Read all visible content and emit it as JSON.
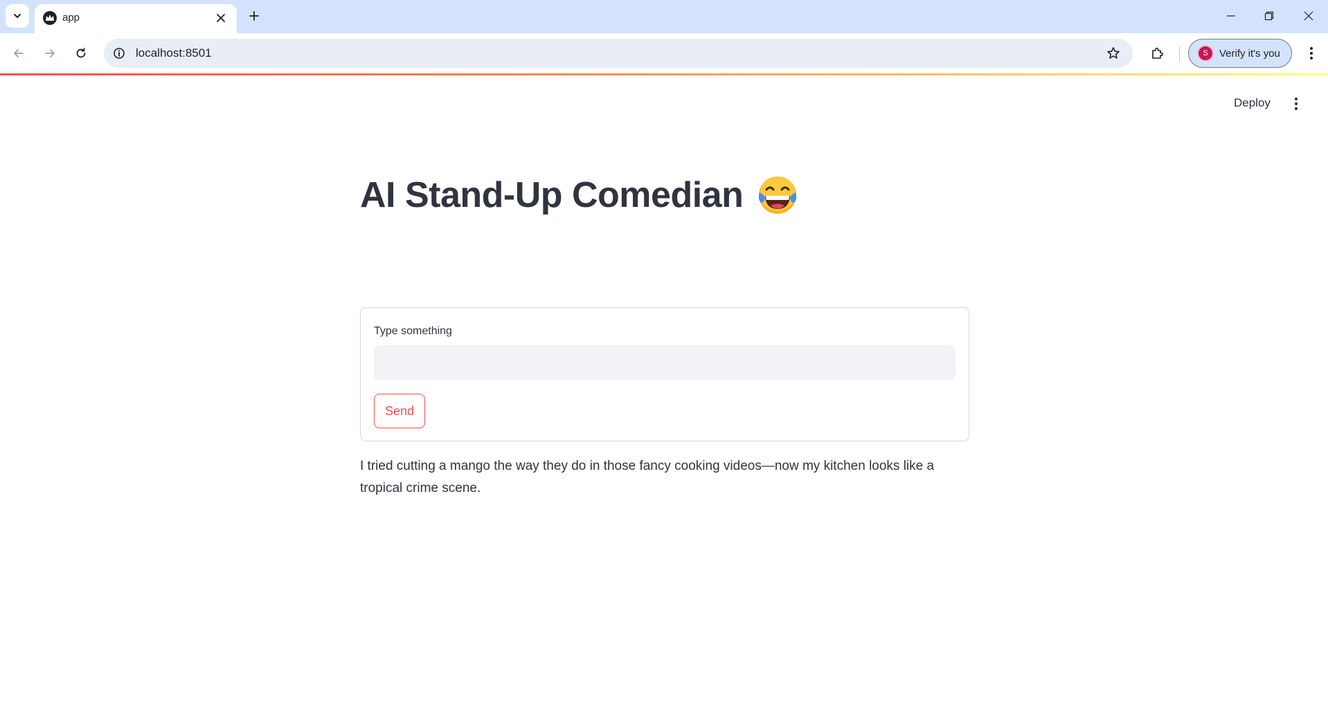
{
  "browser": {
    "tab": {
      "title": "app"
    },
    "address_bar": {
      "url": "localhost:8501"
    },
    "profile": {
      "verify_label": "Verify it's you",
      "avatar_initial": "S"
    }
  },
  "app": {
    "header": {
      "deploy_label": "Deploy"
    },
    "title": "AI Stand-Up Comedian",
    "title_emoji": "face-with-tears-of-joy",
    "form": {
      "input_label": "Type something",
      "input_value": "",
      "submit_label": "Send"
    },
    "output_text": "I tried cutting a mango the way they do in those fancy cooking videos—now my kitchen looks like a tropical crime scene."
  },
  "colors": {
    "primary": "#ff4b4b",
    "text": "#31333f",
    "input_bg": "#f0f2f6",
    "chrome_bg": "#d3e3fd"
  }
}
